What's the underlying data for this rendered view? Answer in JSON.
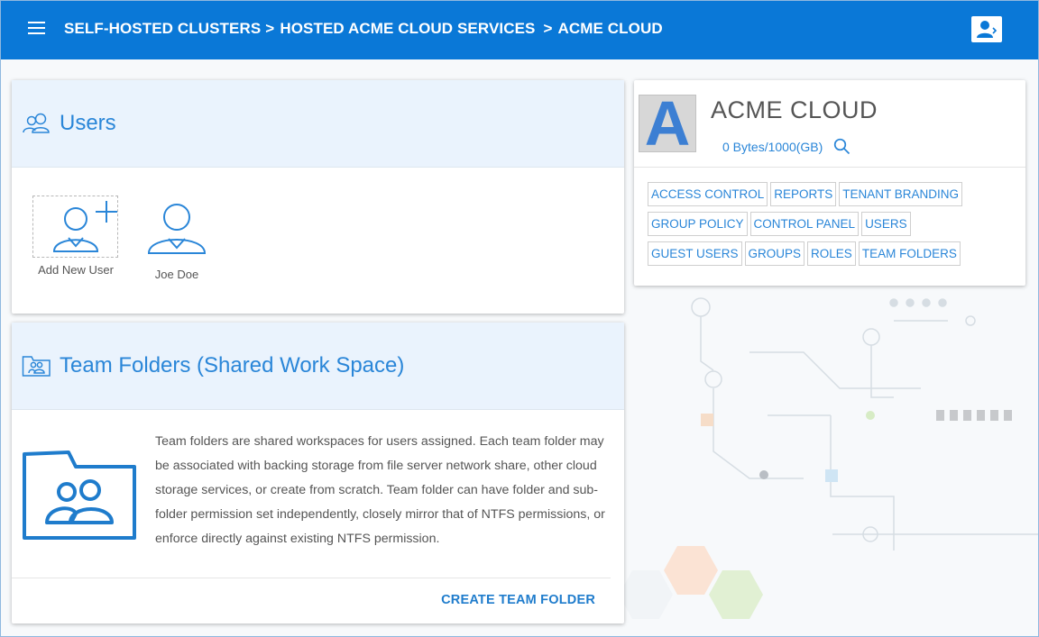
{
  "colors": {
    "accent": "#0a78d7",
    "link": "#2a86d8",
    "header_bg": "#eaf3fd",
    "avatar_letter": "#3c7fd3"
  },
  "header": {
    "menu_icon": "hamburger-icon",
    "breadcrumbs": [
      "SELF-HOSTED CLUSTERS",
      "HOSTED ACME CLOUD SERVICES",
      "ACME CLOUD"
    ],
    "breadcrumb_separator": ">",
    "account_icon": "user-account-icon"
  },
  "users_card": {
    "title": "Users",
    "title_icon": "users-icon",
    "tiles": [
      {
        "label": "Add New User",
        "icon": "add-user-icon"
      },
      {
        "label": "Joe Doe",
        "icon": "user-icon"
      }
    ]
  },
  "team_folders_card": {
    "title": "Team Folders (Shared Work Space)",
    "title_icon": "team-folder-icon",
    "description": "Team folders are shared workspaces for users assigned. Each team folder may be associated with backing storage from file server network share, other cloud storage services, or create from scratch. Team folder can have folder and sub-folder permission set independently, closely mirror that of NTFS permissions, or enforce directly against existing NTFS permission.",
    "create_button": "CREATE TEAM FOLDER"
  },
  "tenant_card": {
    "avatar_letter": "A",
    "name": "ACME CLOUD",
    "quota": "0 Bytes/1000(GB)",
    "search_icon": "search-icon",
    "tags": [
      "ACCESS CONTROL",
      "REPORTS",
      "TENANT BRANDING",
      "GROUP POLICY",
      "CONTROL PANEL",
      "USERS",
      "GUEST USERS",
      "GROUPS",
      "ROLES",
      "TEAM FOLDERS"
    ]
  }
}
